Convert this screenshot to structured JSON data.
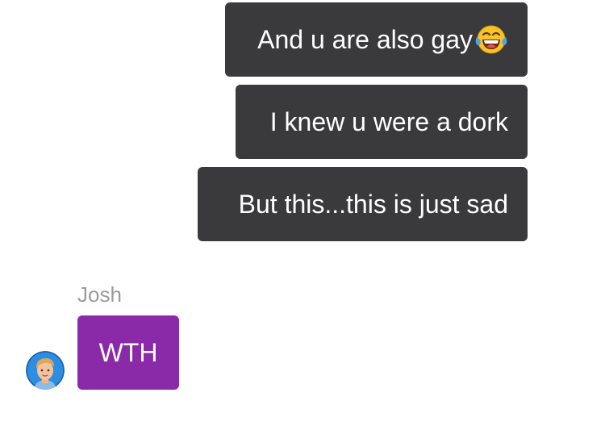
{
  "conversation": {
    "messages_outgoing": [
      {
        "text": "And u are also gay",
        "emoji": "face-with-tears-of-joy-icon"
      },
      {
        "text": "I knew u were a dork"
      },
      {
        "text": "But this...this is just sad"
      }
    ],
    "incoming": {
      "sender": "Josh",
      "text": "WTH",
      "avatar_icon": "josh-avatar"
    }
  },
  "colors": {
    "outgoing_bubble": "#3a3a3c",
    "incoming_bubble": "#8b2aa8",
    "sender_name": "#9b9b9b",
    "background": "#ffffff"
  }
}
